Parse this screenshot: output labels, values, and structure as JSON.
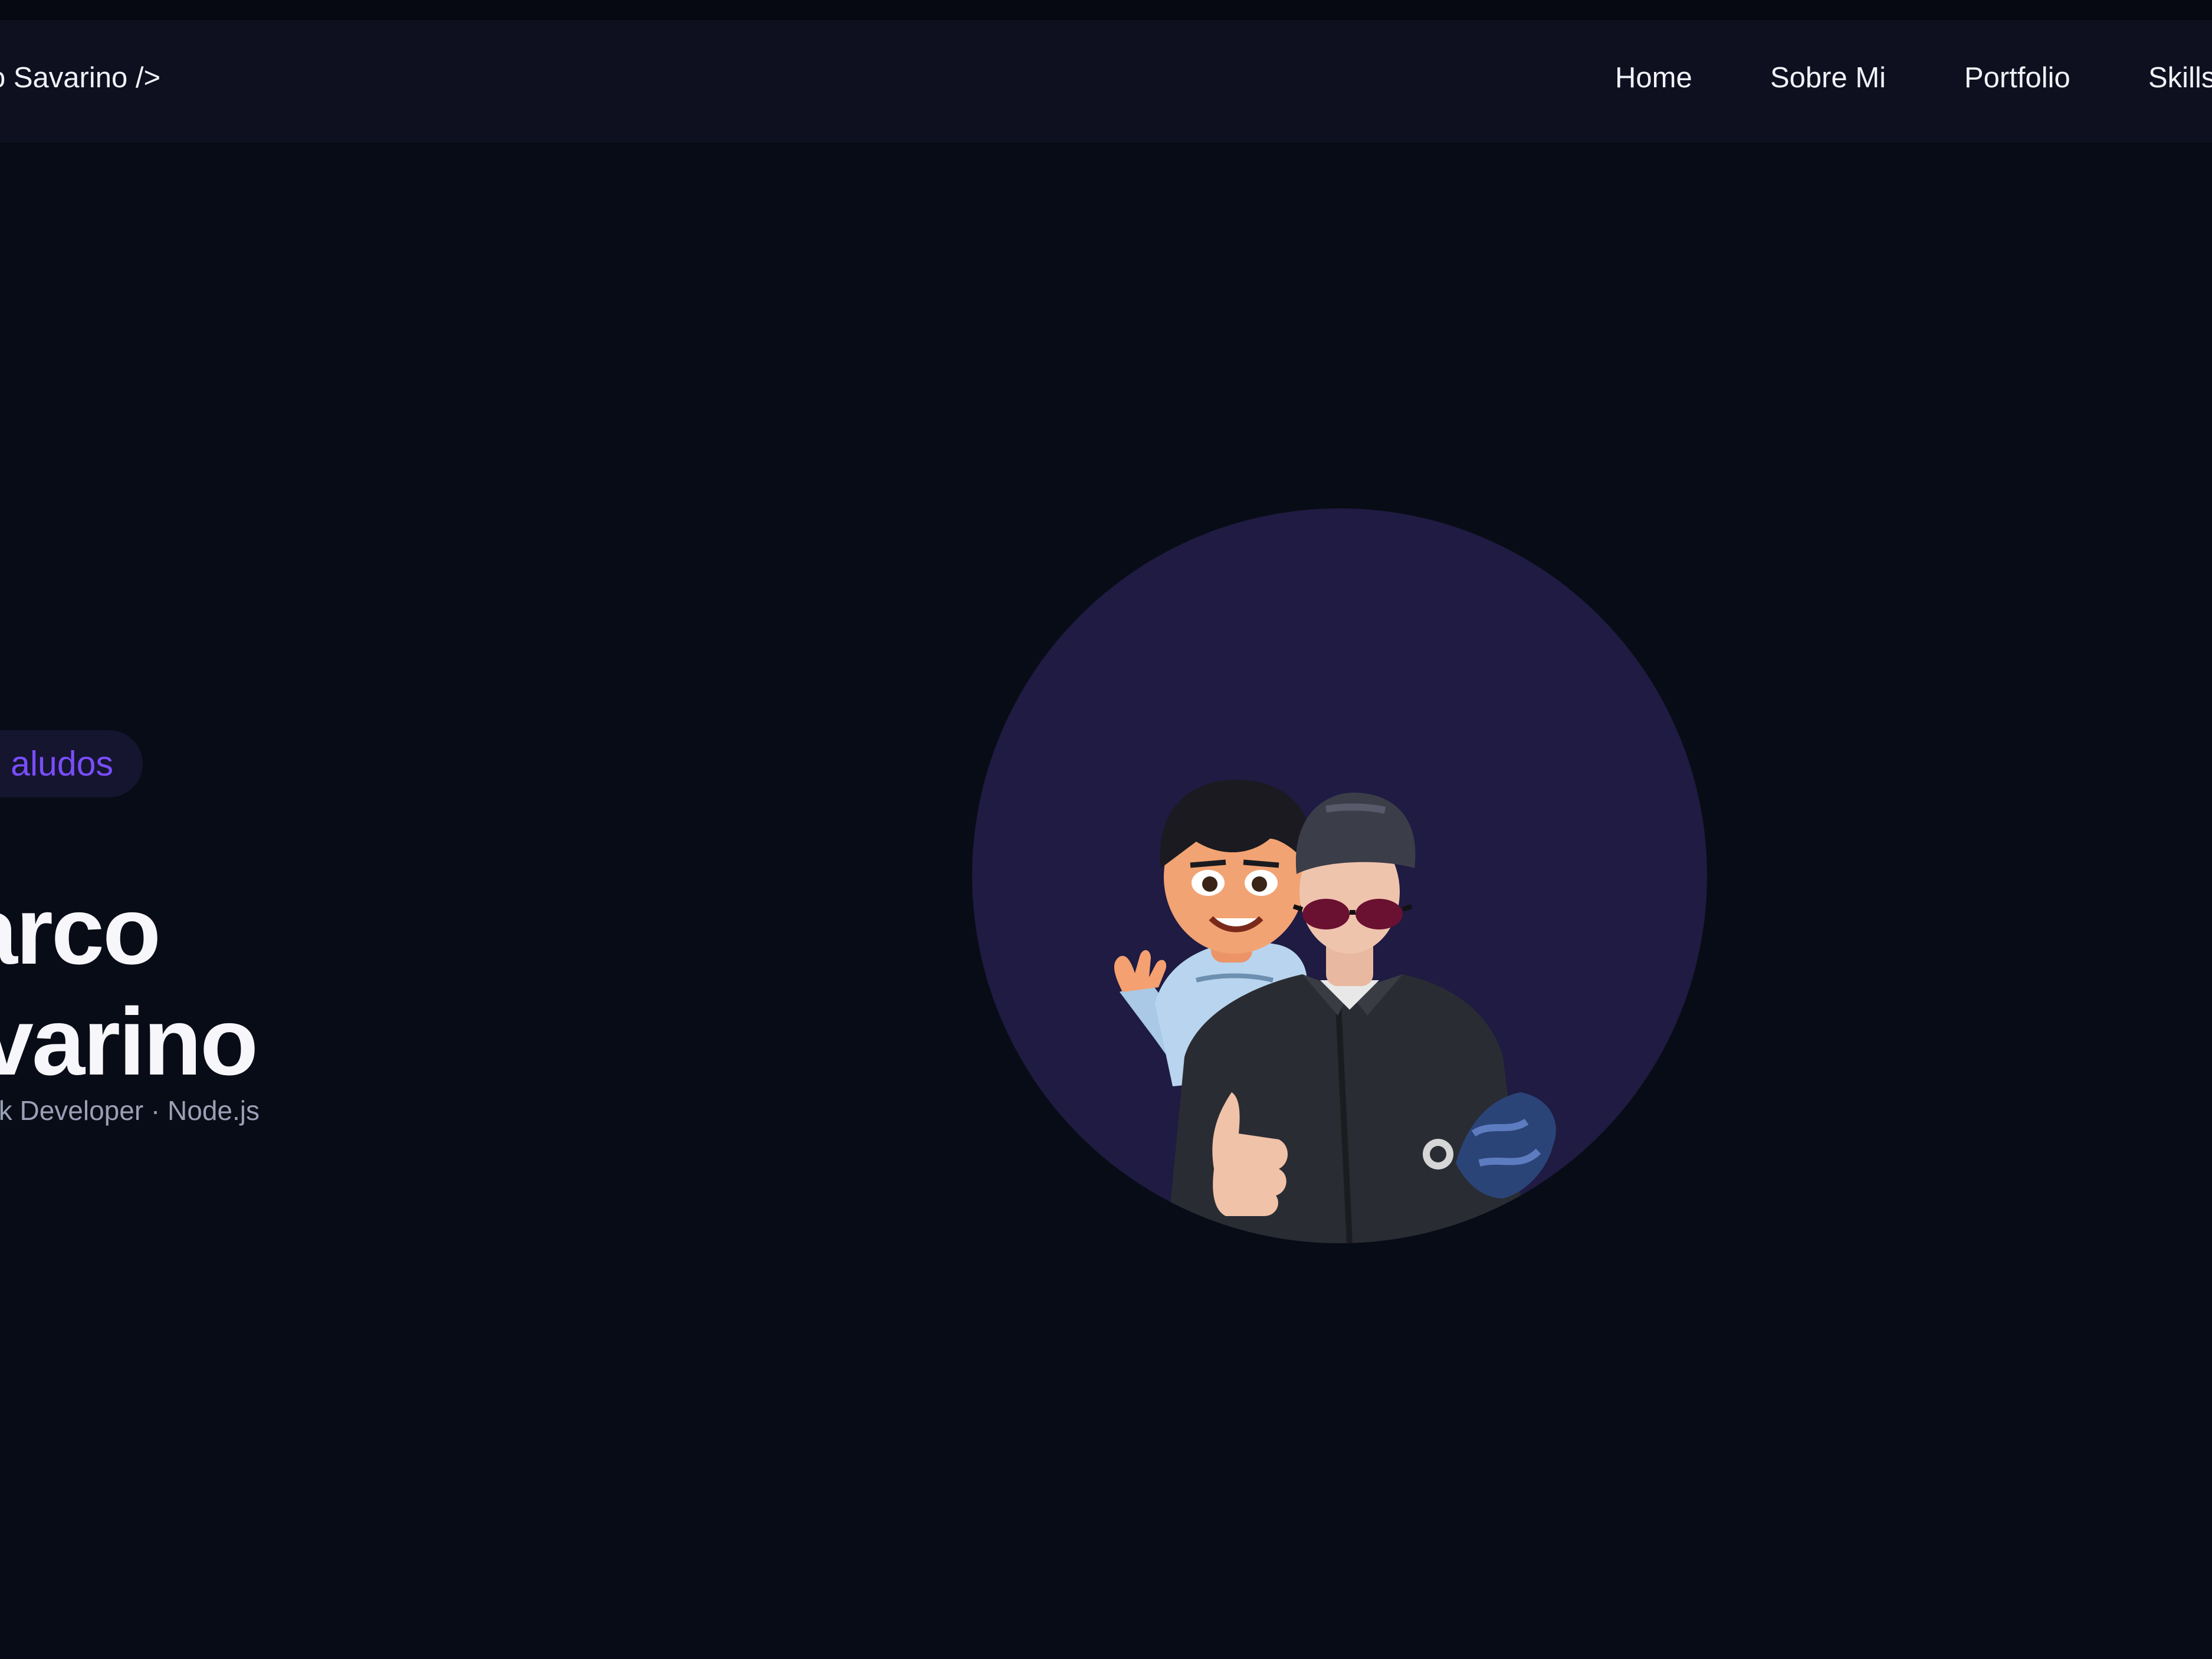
{
  "nav": {
    "brand": "o Savarino />",
    "links": [
      "Home",
      "Sobre Mi",
      "Portfolio",
      "Skills"
    ]
  },
  "hero": {
    "greeting": "aludos",
    "name_line_1": "arco",
    "name_line_2": "varino",
    "subtitle": "k Developer · Node.js"
  },
  "colors": {
    "background": "#080c16",
    "navbar": "#0e1020",
    "accent": "#7a4dfa",
    "avatar_circle": "#1f1b42"
  }
}
